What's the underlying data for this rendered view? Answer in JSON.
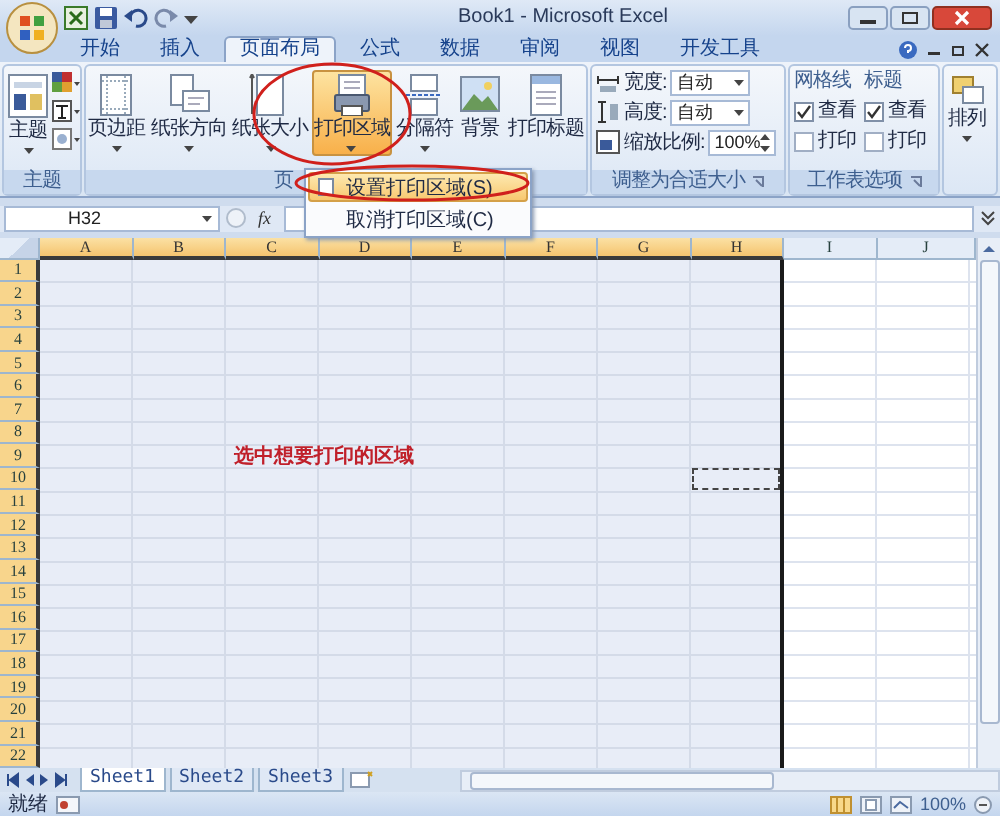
{
  "window": {
    "title": "Book1 - Microsoft Excel"
  },
  "tabs": [
    {
      "label": "开始",
      "selected": false
    },
    {
      "label": "插入",
      "selected": false
    },
    {
      "label": "页面布局",
      "selected": true
    },
    {
      "label": "公式",
      "selected": false
    },
    {
      "label": "数据",
      "selected": false
    },
    {
      "label": "审阅",
      "selected": false
    },
    {
      "label": "视图",
      "selected": false
    },
    {
      "label": "开发工具",
      "selected": false
    }
  ],
  "ribbon": {
    "theme_group": {
      "label": "主题",
      "button": "主题"
    },
    "page_setup_group": {
      "label": "页",
      "buttons": [
        {
          "label": "页边距",
          "kind": "margins",
          "pressed": false
        },
        {
          "label": "纸张方向",
          "kind": "orientation",
          "pressed": false
        },
        {
          "label": "纸张大小",
          "kind": "size",
          "pressed": false
        },
        {
          "label": "打印区域",
          "kind": "printarea",
          "pressed": true
        },
        {
          "label": "分隔符",
          "kind": "breaks",
          "pressed": false
        },
        {
          "label": "背景",
          "kind": "background",
          "pressed": false
        },
        {
          "label": "打印标题",
          "kind": "titles",
          "pressed": false
        }
      ]
    },
    "scale_group": {
      "label": "调整为合适大小",
      "fields": [
        {
          "label": "宽度:",
          "value": "自动",
          "kind": "dropdown"
        },
        {
          "label": "高度:",
          "value": "自动",
          "kind": "dropdown"
        },
        {
          "label": "缩放比例:",
          "value": "100%",
          "kind": "spinner"
        }
      ]
    },
    "sheet_options_group": {
      "label": "工作表选项",
      "columns": [
        {
          "heading": "网格线",
          "options": [
            {
              "label": "查看",
              "checked": true
            },
            {
              "label": "打印",
              "checked": false
            }
          ]
        },
        {
          "heading": "标题",
          "options": [
            {
              "label": "查看",
              "checked": true
            },
            {
              "label": "打印",
              "checked": false
            }
          ]
        }
      ]
    },
    "arrange_button": {
      "label": "排列"
    }
  },
  "dropdown_menu": {
    "items": [
      {
        "label": "设置打印区域(S)",
        "selected": true
      },
      {
        "label": "取消打印区域(C)",
        "selected": false
      }
    ]
  },
  "formula_bar": {
    "name_box": "H32",
    "function_label": "fx"
  },
  "sheet": {
    "columns": [
      {
        "label": "A",
        "selected": true
      },
      {
        "label": "B",
        "selected": true
      },
      {
        "label": "C",
        "selected": true
      },
      {
        "label": "D",
        "selected": true
      },
      {
        "label": "E",
        "selected": true
      },
      {
        "label": "F",
        "selected": true
      },
      {
        "label": "G",
        "selected": true
      },
      {
        "label": "H",
        "selected": true
      },
      {
        "label": "I",
        "selected": false
      },
      {
        "label": "J",
        "selected": false
      }
    ],
    "rows": [
      {
        "label": "1",
        "selected": true
      },
      {
        "label": "2",
        "selected": true
      },
      {
        "label": "3",
        "selected": true
      },
      {
        "label": "4",
        "selected": true
      },
      {
        "label": "5",
        "selected": true
      },
      {
        "label": "6",
        "selected": true
      },
      {
        "label": "7",
        "selected": true
      },
      {
        "label": "8",
        "selected": true
      },
      {
        "label": "9",
        "selected": true
      },
      {
        "label": "10",
        "selected": true
      },
      {
        "label": "11",
        "selected": true
      },
      {
        "label": "12",
        "selected": true
      },
      {
        "label": "13",
        "selected": true
      },
      {
        "label": "14",
        "selected": true
      },
      {
        "label": "15",
        "selected": true
      },
      {
        "label": "16",
        "selected": true
      },
      {
        "label": "17",
        "selected": true
      },
      {
        "label": "18",
        "selected": true
      },
      {
        "label": "19",
        "selected": true
      },
      {
        "label": "20",
        "selected": true
      },
      {
        "label": "21",
        "selected": true
      },
      {
        "label": "22",
        "selected": true
      }
    ],
    "note": {
      "text": "选中想要打印的区域"
    },
    "copy_marquee": true
  },
  "sheet_tabs": [
    {
      "label": "Sheet1",
      "selected": true
    },
    {
      "label": "Sheet2",
      "selected": false
    },
    {
      "label": "Sheet3",
      "selected": false
    }
  ],
  "status_bar": {
    "mode": "就绪",
    "zoom": "100%"
  },
  "annotations": [
    {
      "kind": "ellipse"
    },
    {
      "kind": "ellipse"
    }
  ]
}
